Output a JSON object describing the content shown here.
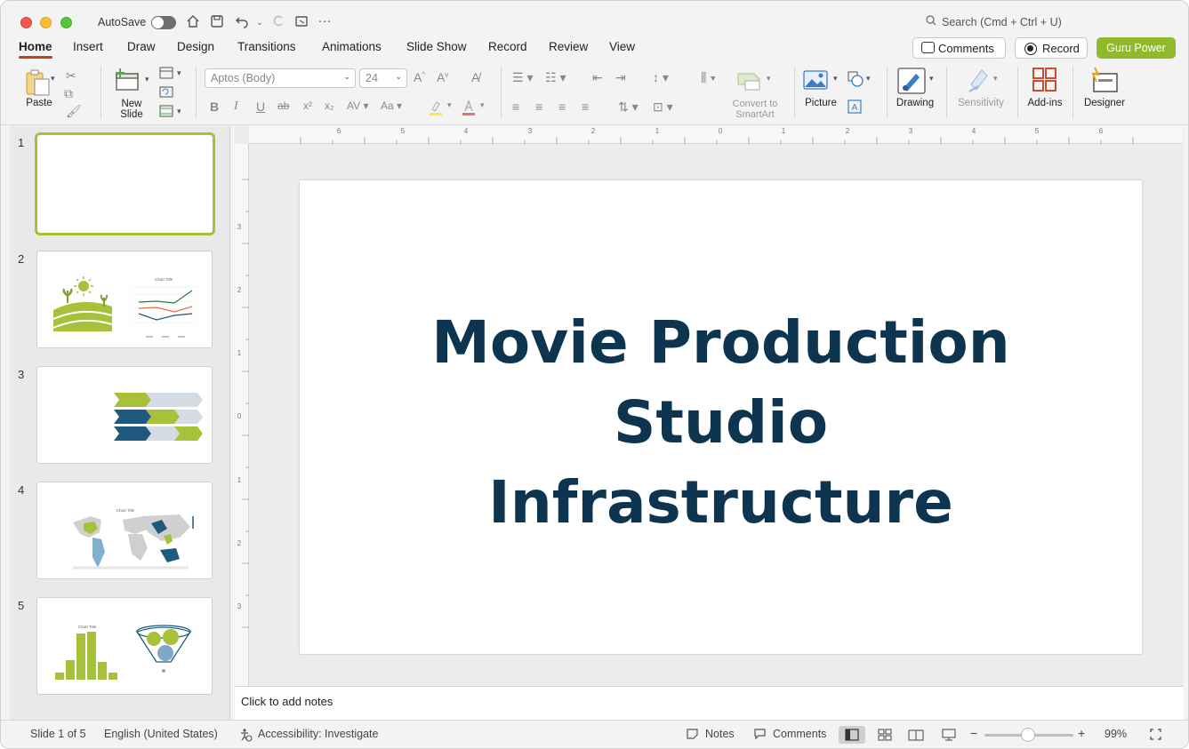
{
  "titlebar": {
    "autosave_label": "AutoSave",
    "search_placeholder": "Search (Cmd + Ctrl + U)"
  },
  "tabs": [
    {
      "label": "Home",
      "active": true
    },
    {
      "label": "Insert"
    },
    {
      "label": "Draw"
    },
    {
      "label": "Design"
    },
    {
      "label": "Transitions"
    },
    {
      "label": "Animations"
    },
    {
      "label": "Slide Show"
    },
    {
      "label": "Record"
    },
    {
      "label": "Review"
    },
    {
      "label": "View"
    }
  ],
  "header_buttons": {
    "comments": "Comments",
    "record": "Record",
    "guru": "Guru Power",
    "guru_color": "#8fba2c"
  },
  "ribbon": {
    "paste": "Paste",
    "new_slide_line1": "New",
    "new_slide_line2": "Slide",
    "font_name": "Aptos (Body)",
    "font_size": "24",
    "convert_line1": "Convert to",
    "convert_line2": "SmartArt",
    "picture": "Picture",
    "drawing": "Drawing",
    "sensitivity": "Sensitivity",
    "addins": "Add-ins",
    "designer": "Designer"
  },
  "thumbnails": [
    {
      "num": "1",
      "selected": true
    },
    {
      "num": "2"
    },
    {
      "num": "3"
    },
    {
      "num": "4"
    },
    {
      "num": "5"
    }
  ],
  "thumb_texts": {
    "chart_title": "Chart Title"
  },
  "ruler": {
    "h_labels": [
      "6",
      "5",
      "4",
      "3",
      "2",
      "1",
      "0",
      "1",
      "2",
      "3",
      "4",
      "5",
      "6"
    ],
    "v_labels": [
      "3",
      "2",
      "1",
      "0",
      "1",
      "2",
      "3"
    ]
  },
  "slide": {
    "title_line1": "Movie Production",
    "title_line2": "Studio",
    "title_line3": "Infrastructure",
    "title_color": "#0d3550"
  },
  "notes": {
    "placeholder": "Click to add notes"
  },
  "status": {
    "slide_info": "Slide 1 of 5",
    "language": "English (United States)",
    "accessibility": "Accessibility: Investigate",
    "notes": "Notes",
    "comments": "Comments",
    "zoom": "99%"
  },
  "colors": {
    "accent_green": "#a7c23a",
    "dark_blue": "#1f5a7e",
    "tab_underline": "#c43e1c"
  }
}
